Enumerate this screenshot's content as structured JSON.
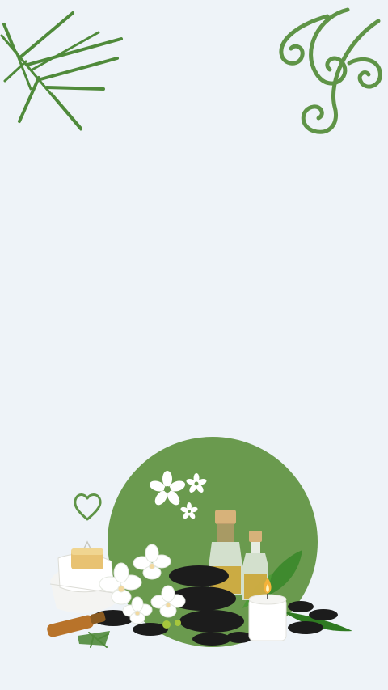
{
  "canvas": {
    "background": "#eef3f8"
  },
  "decor": {
    "top_left": "rosemary-sprig",
    "top_right": "swirl-ornament",
    "heart": "heart-outline"
  },
  "spa_scene": {
    "circle_color": "#6a9a4e",
    "flowers": "white-flower-icons",
    "items": [
      "towels",
      "soap-bar",
      "orchids",
      "black-stones",
      "oil-bottles",
      "candle",
      "brush",
      "leaves"
    ]
  },
  "colors": {
    "accent_green": "#5f9447",
    "stone_black": "#1c1c1c",
    "candle_flame": "#f4b23a"
  }
}
